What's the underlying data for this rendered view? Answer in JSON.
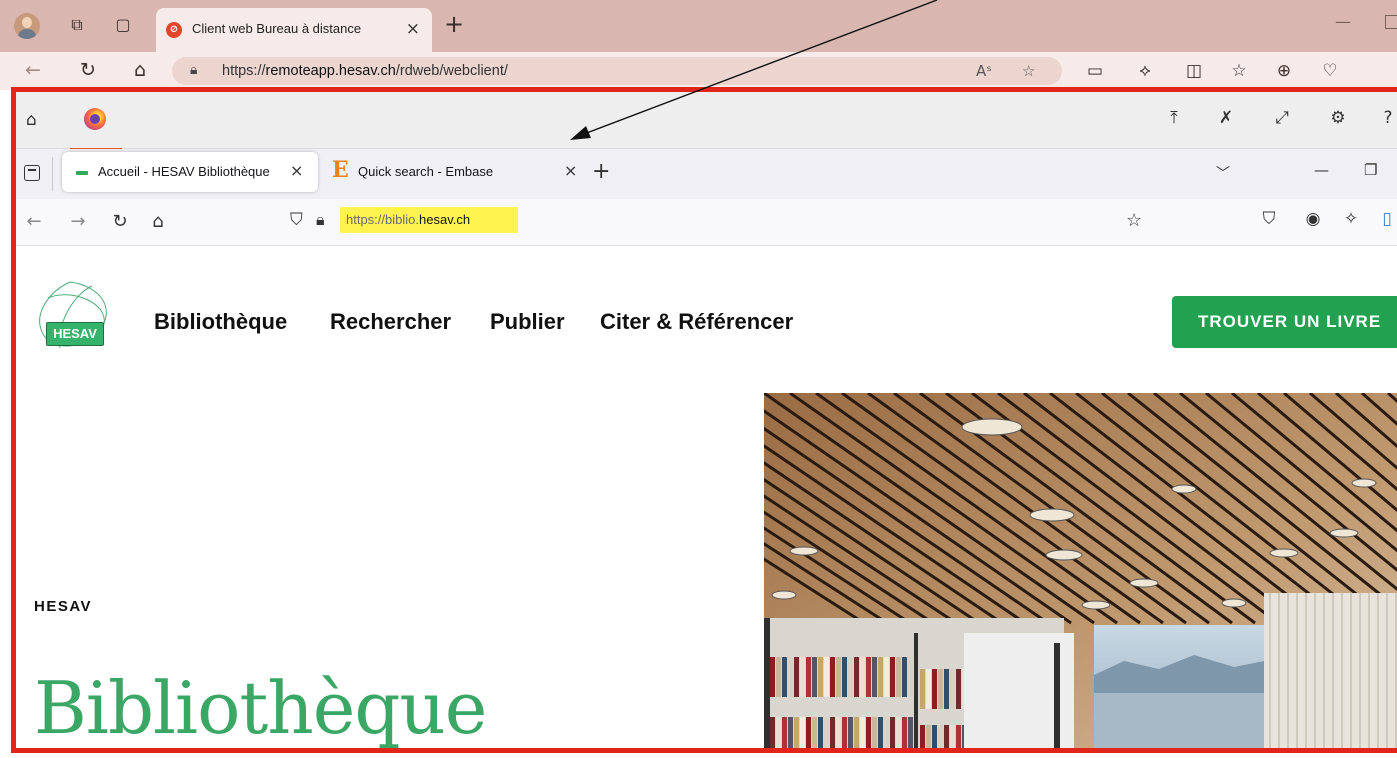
{
  "edge": {
    "tab_title": "Client web Bureau à distance",
    "tab_close": "×",
    "new_tab": "+",
    "url_prefix": "https://",
    "url_host": "remoteapp.hesav.ch",
    "url_path": "/rdweb/webclient/"
  },
  "firefox": {
    "tabs": [
      {
        "title": "Accueil - HESAV Bibliothèque",
        "close": "×",
        "active": true
      },
      {
        "title": "Quick search - Embase",
        "close": "×",
        "active": false,
        "favicon": "E"
      }
    ],
    "new_tab": "+",
    "url_prefix": "https://biblio.",
    "url_host": "hesav.ch"
  },
  "page": {
    "logo_text": "HESAV",
    "nav": [
      "Bibliothèque",
      "Rechercher",
      "Publier",
      "Citer & Référencer"
    ],
    "cta_label": "TROUVER UN LIVRE",
    "hero_eyebrow": "HESAV",
    "hero_title": "Bibliothèque"
  },
  "colors": {
    "edge_frame": "#d9b7b0",
    "annotation_red": "#e1251b",
    "url_highlight": "#fff34f",
    "hesav_green": "#22a251",
    "title_green": "#3aa765"
  },
  "icons": {
    "edge_toolbar": [
      "back-icon",
      "refresh-icon",
      "home-icon",
      "lock-icon",
      "read-aloud-icon",
      "favorite-star-icon",
      "reading-view-icon",
      "extensions-icon",
      "split-screen-icon",
      "favorites-icon",
      "collections-icon",
      "performance-icon"
    ],
    "remote_bar": [
      "home-icon",
      "firefox-icon",
      "pin-top-icon",
      "unpin-icon",
      "expand-icon",
      "settings-icon",
      "help-icon"
    ],
    "firefox_nav": [
      "back-icon",
      "forward-icon",
      "reload-icon",
      "home-icon",
      "shield-icon",
      "lock-icon",
      "bookmark-star-icon",
      "pocket-icon",
      "account-icon",
      "extensions-icon",
      "reader-icon"
    ]
  }
}
